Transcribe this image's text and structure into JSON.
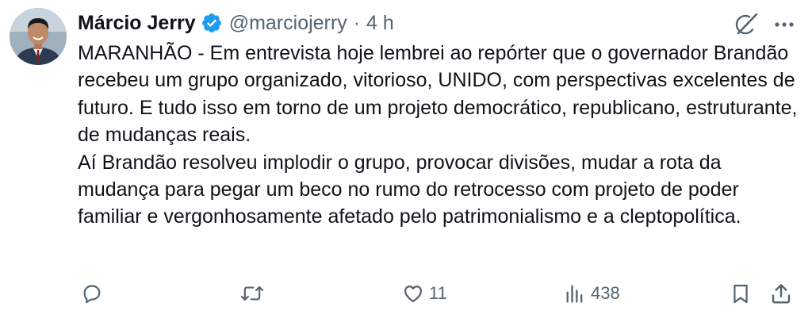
{
  "author": {
    "display_name": "Márcio Jerry",
    "handle": "@marciojerry",
    "separator": "·",
    "time": "4 h",
    "avatar_icon": "avatar-photo",
    "verified_icon": "verified-badge-icon",
    "verified_color": "#1d9bf0"
  },
  "header_icons": {
    "grok": "grok-icon",
    "more": "more-icon"
  },
  "tweet": {
    "paragraph_1": "MARANHÃO - Em entrevista hoje lembrei ao repórter que o governador Brandão recebeu um grupo organizado, vitorioso, UNIDO, com perspectivas excelentes de futuro. E tudo isso em torno de um projeto democrático, republicano, estruturante, de mudanças reais.",
    "paragraph_2": "Aí Brandão resolveu implodir o grupo, provocar divisões,  mudar a rota da mudança para pegar um beco no rumo do retrocesso com projeto de poder familiar e vergonhosamente afetado pelo patrimonialismo e a cleptopolítica."
  },
  "actions": {
    "reply": {
      "icon": "reply-icon",
      "count": ""
    },
    "retweet": {
      "icon": "retweet-icon",
      "count": ""
    },
    "like": {
      "icon": "like-icon",
      "count": "11"
    },
    "views": {
      "icon": "views-icon",
      "count": "438"
    },
    "bookmark": {
      "icon": "bookmark-icon"
    },
    "share": {
      "icon": "share-icon"
    }
  },
  "colors": {
    "text_primary": "#0f1419",
    "text_secondary": "#536471",
    "icon": "#536471",
    "background": "#ffffff"
  }
}
